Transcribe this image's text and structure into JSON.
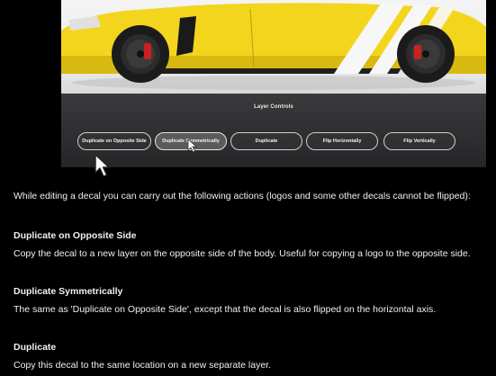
{
  "panel": {
    "title": "Layer Controls",
    "buttons": [
      {
        "label": "Duplicate on Opposite Side",
        "active": false
      },
      {
        "label": "Duplicate Symmetrically",
        "active": true
      },
      {
        "label": "Duplicate",
        "active": false
      },
      {
        "label": "Flip Horizontally",
        "active": false
      },
      {
        "label": "Flip Vertically",
        "active": false
      }
    ]
  },
  "colors": {
    "car_yellow": "#f3d51d",
    "stripe_white": "#f7f7f7",
    "tire": "#1b1b1b"
  },
  "doc": {
    "intro": "While editing a decal you can carry out the following actions (logos and some other decals cannot be flipped):",
    "sections": [
      {
        "title": "Duplicate on Opposite Side",
        "body": "Copy the decal to a new layer on the opposite side of the body. Useful for copying a logo to the opposite side."
      },
      {
        "title": "Duplicate Symmetrically",
        "body": "The same as 'Duplicate on Opposite Side', except that the decal is also flipped on the horizontal axis."
      },
      {
        "title": "Duplicate",
        "body": "Copy this decal to the same location on a new separate layer."
      }
    ]
  }
}
